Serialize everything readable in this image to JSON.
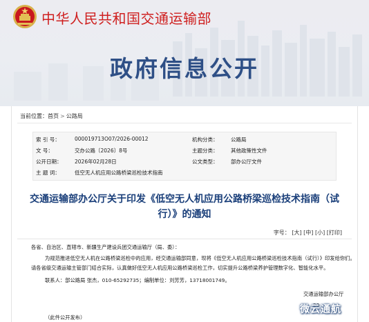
{
  "header": {
    "ministry_name": "中华人民共和国交通运输部",
    "banner_title": "政府信息公开"
  },
  "breadcrumb": {
    "prefix": "当前位置：",
    "items": [
      "首页",
      "公路局"
    ],
    "separator": ">"
  },
  "meta": {
    "rows": [
      {
        "label1": "索 引 号：",
        "value1": "000019713O07/2026-00012",
        "label2": "机构分类：",
        "value2": "公路局"
      },
      {
        "label1": "文     号：",
        "value1": "交办公路〔2026〕8号",
        "label2": "主题分类：",
        "value2": "其他政策性文件"
      },
      {
        "label1": "公开日期：",
        "value1": "2026年02月28日",
        "label2": "公文类型：",
        "value2": "部办公厅文件"
      },
      {
        "label1": "主 题 词：",
        "value1": "低空无人机应用公路桥梁巡检技术指南",
        "label2": "",
        "value2": ""
      }
    ]
  },
  "document": {
    "title_line1": "交通运输部办公厅关于印发《低空无人机应用公路桥梁巡检技术指南（试",
    "title_line2": "行）》的通知",
    "font_size_label": "字号：",
    "font_sizes": [
      "大",
      "中",
      "小"
    ],
    "print_label": "打印",
    "salutation": "各省、自治区、直辖市、新疆生产建设兵团交通运输厅（局、委）：",
    "body_line1": "为规范推进低空无人机在公路桥梁巡检中的应用，经交通运输部同意，现将《低空无人机应用公路桥梁巡检技术指南（试行）》印发给你们。",
    "body_line2": "请各省级交通运输主管部门结合实际，认真做好低空无人机应用公路桥梁巡检工作，切实提升公路桥梁养护管理数字化、智能化水平。",
    "contact": "联系人：部公路局 张杰，010-65292735；编制单位：刘芳芳，13718001749。",
    "signature": "交通运输部办公厅",
    "date_partial": "20",
    "public_note": "（此件公开发布）"
  },
  "watermark": "微云通航",
  "colors": {
    "ministry_red": "#cf1f1f",
    "banner_blue": "#2e4f86",
    "title_blue": "#1a3f7a"
  }
}
